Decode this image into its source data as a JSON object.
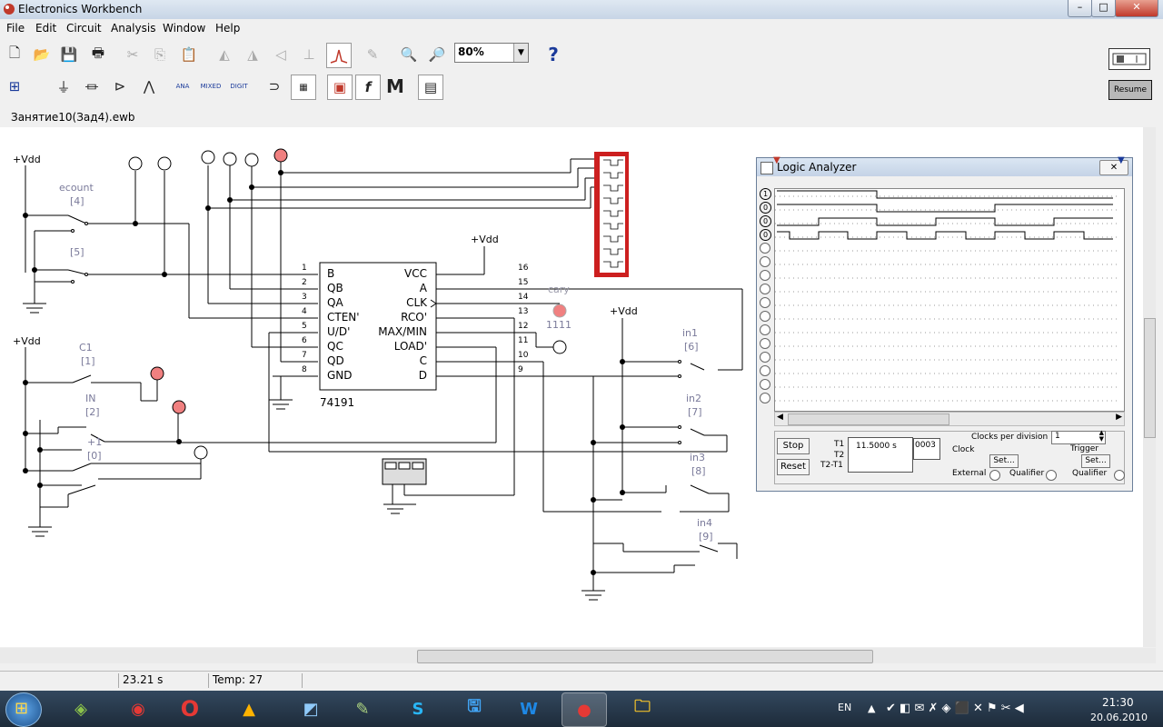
{
  "window": {
    "title": "Electronics Workbench",
    "minimize": "–",
    "maximize": "□",
    "close": "✕"
  },
  "menu": [
    "File",
    "Edit",
    "Circuit",
    "Analysis",
    "Window",
    "Help"
  ],
  "toolbar": {
    "zoom_value": "80%",
    "help_label": "?",
    "resume_label": "Resume",
    "parts_labels": {
      "analog": "ANA",
      "mixed": "MIXED",
      "digital": "DIGIT",
      "function": "f",
      "misc": "M"
    }
  },
  "document": {
    "filename": "Занятие10(Зад4).ewb"
  },
  "circuit": {
    "vdd_label": "+Vdd",
    "switches": [
      {
        "name": "ecount",
        "key": "[4]"
      },
      {
        "name": "",
        "key": "[5]"
      },
      {
        "name": "C1",
        "key": "[1]"
      },
      {
        "name": "IN",
        "key": "[2]"
      },
      {
        "name": "+1",
        "key": "[0]"
      },
      {
        "name": "in1",
        "key": "[6]"
      },
      {
        "name": "in2",
        "key": "[7]"
      },
      {
        "name": "in3",
        "key": "[8]"
      },
      {
        "name": "in4",
        "key": "[9]"
      }
    ],
    "chip": {
      "name": "74191",
      "left_pins": [
        {
          "num": "1",
          "label": "B"
        },
        {
          "num": "2",
          "label": "QB"
        },
        {
          "num": "3",
          "label": "QA"
        },
        {
          "num": "4",
          "label": "CTEN'"
        },
        {
          "num": "5",
          "label": "U/D'"
        },
        {
          "num": "6",
          "label": "QC"
        },
        {
          "num": "7",
          "label": "QD"
        },
        {
          "num": "8",
          "label": "GND"
        }
      ],
      "right_pins": [
        {
          "num": "16",
          "label": "VCC"
        },
        {
          "num": "15",
          "label": "A"
        },
        {
          "num": "14",
          "label": "CLK"
        },
        {
          "num": "13",
          "label": "RCO'"
        },
        {
          "num": "12",
          "label": "MAX/MIN"
        },
        {
          "num": "11",
          "label": "LOAD'"
        },
        {
          "num": "10",
          "label": "C"
        },
        {
          "num": "9",
          "label": "D"
        }
      ]
    },
    "probe_name": "cary",
    "probe_value": "1111"
  },
  "logic_analyzer": {
    "title": "Logic Analyzer",
    "channel_markers": [
      "1",
      "0",
      "0",
      "0"
    ],
    "traces": [
      [
        [
          0,
          1
        ],
        [
          110,
          1
        ],
        [
          110,
          0
        ],
        [
          370,
          0
        ]
      ],
      [
        [
          0,
          1
        ],
        [
          110,
          1
        ],
        [
          110,
          0
        ],
        [
          240,
          0
        ],
        [
          240,
          1
        ],
        [
          370,
          1
        ]
      ],
      [
        [
          0,
          0
        ],
        [
          46,
          0
        ],
        [
          46,
          1
        ],
        [
          110,
          1
        ],
        [
          110,
          0
        ],
        [
          175,
          0
        ],
        [
          175,
          1
        ],
        [
          240,
          1
        ],
        [
          240,
          0
        ],
        [
          305,
          0
        ],
        [
          305,
          1
        ],
        [
          370,
          1
        ]
      ],
      [
        [
          0,
          1
        ],
        [
          14,
          1
        ],
        [
          14,
          0
        ],
        [
          46,
          0
        ],
        [
          46,
          1
        ],
        [
          78,
          1
        ],
        [
          78,
          0
        ],
        [
          110,
          0
        ],
        [
          110,
          1
        ],
        [
          143,
          1
        ],
        [
          143,
          0
        ],
        [
          175,
          0
        ],
        [
          175,
          1
        ],
        [
          208,
          1
        ],
        [
          208,
          0
        ],
        [
          240,
          0
        ],
        [
          240,
          1
        ],
        [
          273,
          1
        ],
        [
          273,
          0
        ],
        [
          305,
          0
        ],
        [
          305,
          1
        ],
        [
          338,
          1
        ],
        [
          338,
          0
        ],
        [
          370,
          0
        ]
      ]
    ],
    "stop_label": "Stop",
    "reset_label": "Reset",
    "t1_label": "T1",
    "t2_label": "T2",
    "t2t1_label": "T2-T1",
    "t1_value": "11.5000  s",
    "count_value": "0003",
    "clock_label": "Clock",
    "clocks_per_division_label": "Clocks per division",
    "clocks_per_division_value": "1",
    "trigger_label": "Trigger",
    "set_label": "Set...",
    "external_label": "External",
    "qualifier_label": "Qualifier"
  },
  "status": {
    "time": "23.21 s",
    "temp": "Temp: 27"
  },
  "taskbar": {
    "lang": "EN",
    "time": "21:30",
    "date": "20.06.2010"
  },
  "colors": {
    "probe": "#f08080",
    "bus_connector": "#cc1f1f",
    "taskbar": "#26394c"
  }
}
